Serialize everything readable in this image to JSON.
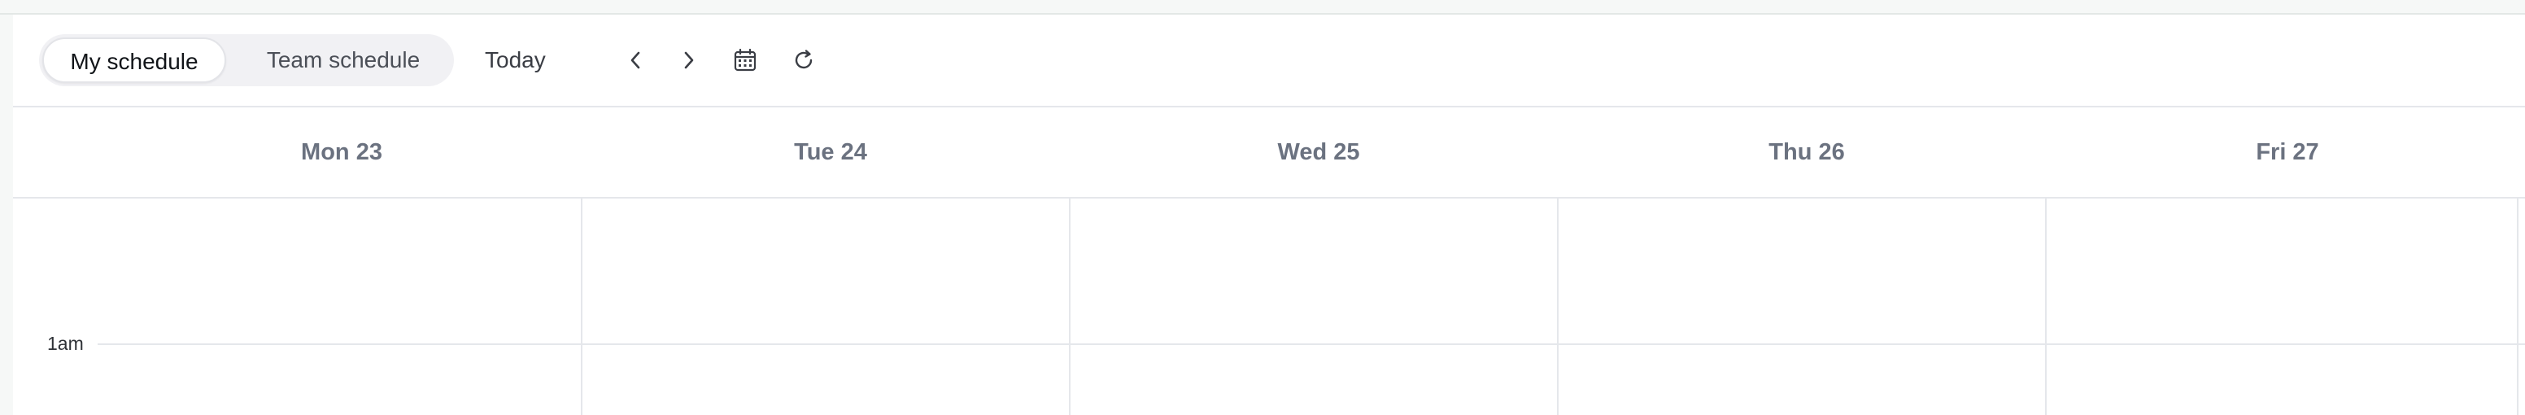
{
  "toolbar": {
    "view_toggle": {
      "my_schedule": "My schedule",
      "team_schedule": "Team schedule",
      "selected": "My schedule"
    },
    "today_label": "Today",
    "icons": {
      "prev": "chevron-left-icon",
      "next": "chevron-right-icon",
      "calendar": "calendar-icon",
      "refresh": "refresh-icon"
    }
  },
  "days": [
    "Mon 23",
    "Tue 24",
    "Wed 25",
    "Thu 26",
    "Fri 27"
  ],
  "time_slots": [
    "1am"
  ],
  "colors": {
    "header_text": "#6b7280",
    "grid_line": "#e5e7eb",
    "toggle_bg": "#f1f1f4"
  }
}
